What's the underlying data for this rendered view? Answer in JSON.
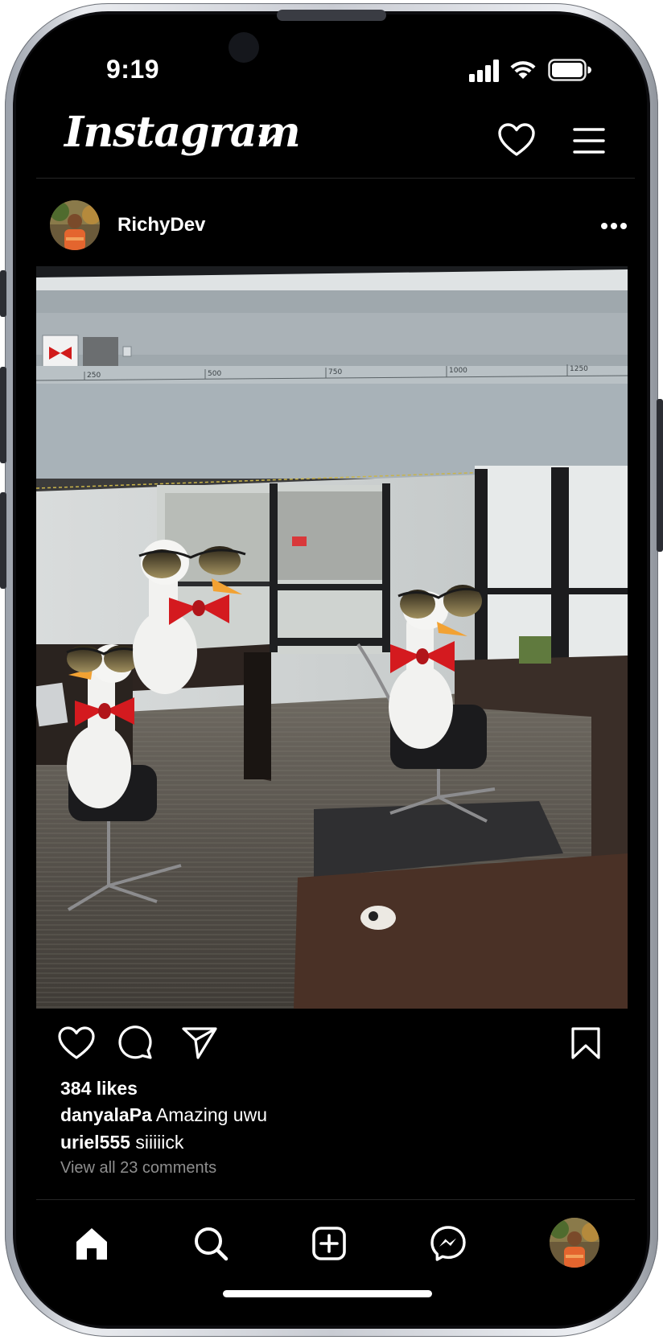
{
  "status_bar": {
    "time": "9:19"
  },
  "header": {
    "logo_text": "Instagram"
  },
  "post": {
    "username": "RichyDev",
    "likes": "384 likes",
    "comments": [
      {
        "user": "danyalaPa",
        "text": "Amazing uwu"
      },
      {
        "user": "uriel555",
        "text": "siiiiick"
      }
    ],
    "view_all": "View all 23 comments",
    "image_ruler_ticks": [
      "250",
      "500",
      "750",
      "1000",
      "1250"
    ]
  },
  "bottom_nav": [
    "home",
    "search",
    "new-post",
    "messenger",
    "profile"
  ],
  "colors": {
    "background": "#000000",
    "text": "#ffffff",
    "muted": "#8e8e8e",
    "divider": "#262626"
  }
}
